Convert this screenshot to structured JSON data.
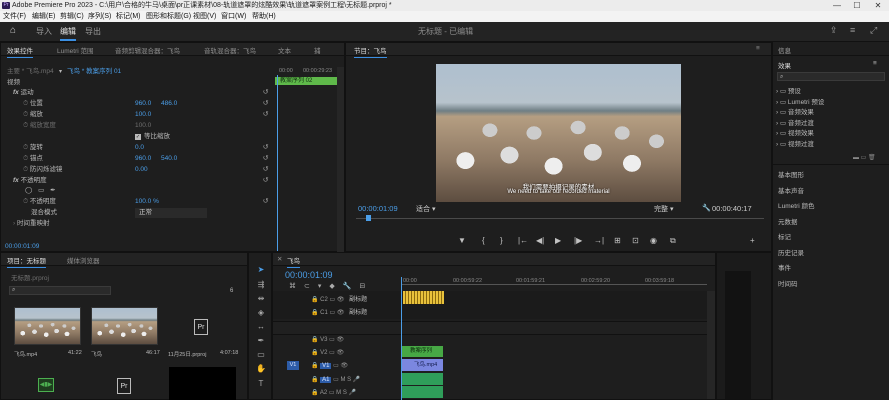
{
  "window": {
    "title": "Adobe Premiere Pro 2023 - C:\\用户\\合格的牛马\\桌面\\pr正课素材\\08-轨道遮罩的炫酷效果\\轨道遮罩案例工程\\无标题.prproj *",
    "app_badge": "Pr",
    "minimize": "—",
    "maximize": "☐",
    "close": "✕"
  },
  "menu": [
    "文件(F)",
    "编辑(E)",
    "剪辑(C)",
    "序列(S)",
    "标记(M)",
    "图形和标题(G)",
    "视图(V)",
    "窗口(W)",
    "帮助(H)"
  ],
  "workspace": {
    "tabs": [
      "导入",
      "编辑",
      "导出"
    ],
    "active": "编辑",
    "project_title": "无标题 - 已编辑"
  },
  "effect_controls": {
    "tabs": [
      "效果控件",
      "Lumetri 范围",
      "音频剪辑混合器：飞鸟",
      "音轨混合器：飞鸟",
      "文本",
      "捕"
    ],
    "active_tab": "效果控件",
    "source_label": "主要 * 飞鸟.mp4",
    "clip_label": "飞鸟 * 教案序列 01",
    "ruler_start": "00:00",
    "ruler_end": "00:00:29:23",
    "clip_name": "教案序列 02",
    "section_video": "视频",
    "motion": "运动",
    "params": [
      {
        "name": "位置",
        "value": "960.0",
        "value2": "486.0"
      },
      {
        "name": "缩放",
        "value": "100.0",
        "value2": ""
      },
      {
        "name": "缩放宽度",
        "value": "100.0",
        "value2": ""
      },
      {
        "name": "",
        "value": "",
        "value2": ""
      },
      {
        "name": "旋转",
        "value": "0.0",
        "value2": ""
      },
      {
        "name": "锚点",
        "value": "960.0",
        "value2": "540.0"
      },
      {
        "name": "防闪烁滤镜",
        "value": "0.00",
        "value2": ""
      }
    ],
    "uniform_scale": "等比缩放",
    "opacity_section": "不透明度",
    "opacity_label": "不透明度",
    "opacity_value": "100.0 %",
    "blend_label": "混合模式",
    "blend_value": "正常",
    "time_remap": "时间重映射",
    "timecode": "00:00:01:09"
  },
  "program": {
    "title": "节目：飞鸟",
    "subtitle_cn": "我们需要拍摄记录的素材",
    "subtitle_en": "We need to take our recorded material",
    "timecode": "00:00:01:09",
    "fit": "适合",
    "quality": "完整",
    "duration": "00:00:40:17",
    "controls": [
      "▼",
      "{",
      "}",
      "|←",
      "◀|",
      "▶",
      "|▶",
      "→|",
      "⊞",
      "⊡",
      "◉",
      "⧉",
      "+"
    ]
  },
  "project": {
    "tabs": [
      "项目：无标题",
      "媒体浏览器"
    ],
    "file": "无标题.prproj",
    "search_placeholder": "",
    "count": "6",
    "items": [
      {
        "name": "飞鸟.mp4",
        "duration": "41:22"
      },
      {
        "name": "飞鸟",
        "duration": "46:17"
      },
      {
        "name": "11月25日.prproj",
        "duration": "4:07:18"
      }
    ]
  },
  "timeline": {
    "title": "飞鸟",
    "timecode": "00:00:01:09",
    "ruler": [
      "00:00",
      "00:00:59:22",
      "00:01:59:21",
      "00:02:59:20",
      "00:03:59:18"
    ],
    "tracks": [
      {
        "id": "C2",
        "label": "副标题"
      },
      {
        "id": "C1",
        "label": "副标题"
      },
      {
        "id": "V3",
        "label": ""
      },
      {
        "id": "V2",
        "label": ""
      },
      {
        "id": "V1",
        "label": ""
      },
      {
        "id": "A1",
        "label": ""
      },
      {
        "id": "A2",
        "label": ""
      }
    ],
    "clip_v2": "教案序列",
    "clip_v1": "飞鸟.mp4",
    "targets": [
      "V1",
      "A1"
    ]
  },
  "right_panel": {
    "info": "信息",
    "effects": "效果",
    "effect_items": [
      "预设",
      "Lumetri 预设",
      "音频效果",
      "音频过渡",
      "视频效果",
      "视频过渡"
    ],
    "sections": [
      "基本图形",
      "基本声音",
      "Lumetri 颜色",
      "元数据",
      "标记",
      "历史记录",
      "事件",
      "时间码"
    ]
  },
  "colors": {
    "accent": "#3b8fe3",
    "clip_green": "#47a845",
    "clip_blue": "#5b6fd6",
    "subtitle_yellow": "#e9c23c",
    "playhead": "#4b9ee8"
  }
}
